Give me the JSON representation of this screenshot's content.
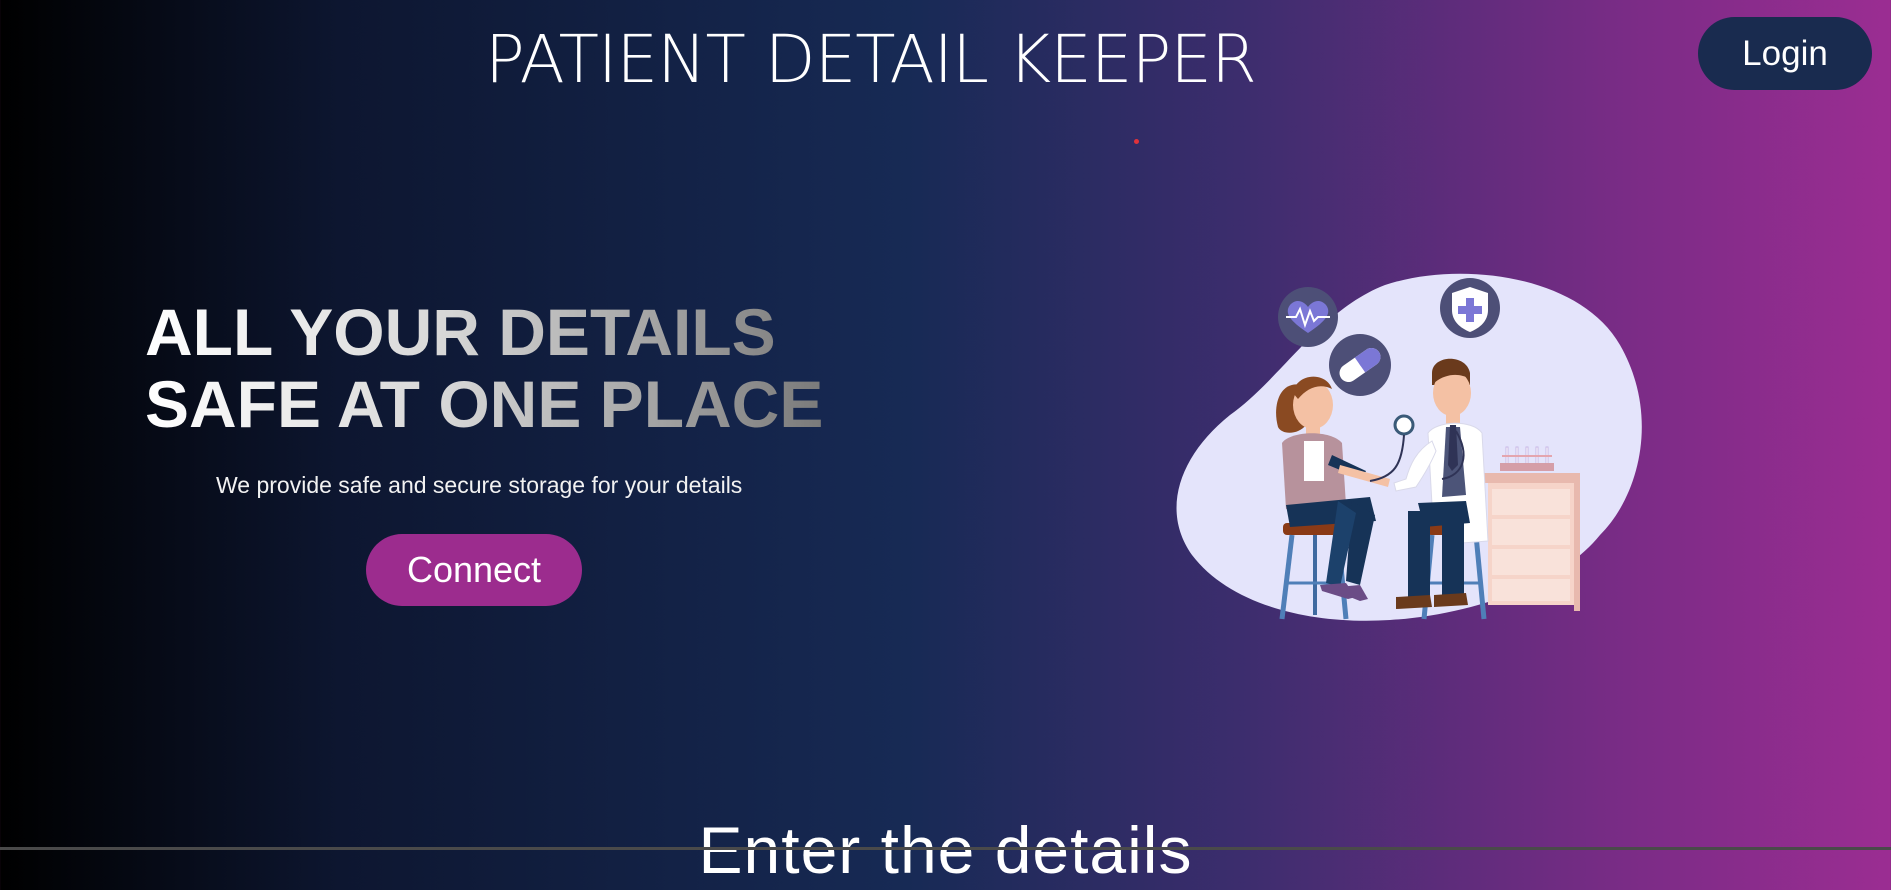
{
  "header": {
    "title": "PATIENT DETAIL KEEPER",
    "login_label": "Login"
  },
  "hero": {
    "headline_line1": "ALL YOUR DETAILS",
    "headline_line2": "SAFE AT ONE PLACE",
    "subtitle": "We provide safe and secure storage for your details",
    "connect_label": "Connect",
    "illustration_icons": [
      "heart-pulse-icon",
      "capsule-icon",
      "medical-shield-icon"
    ]
  },
  "section": {
    "heading": "Enter the details"
  },
  "colors": {
    "login_bg": "#192b4f",
    "connect_bg": "#9c2c8e",
    "gradient_start": "#000000",
    "gradient_end": "#9b2d92"
  }
}
